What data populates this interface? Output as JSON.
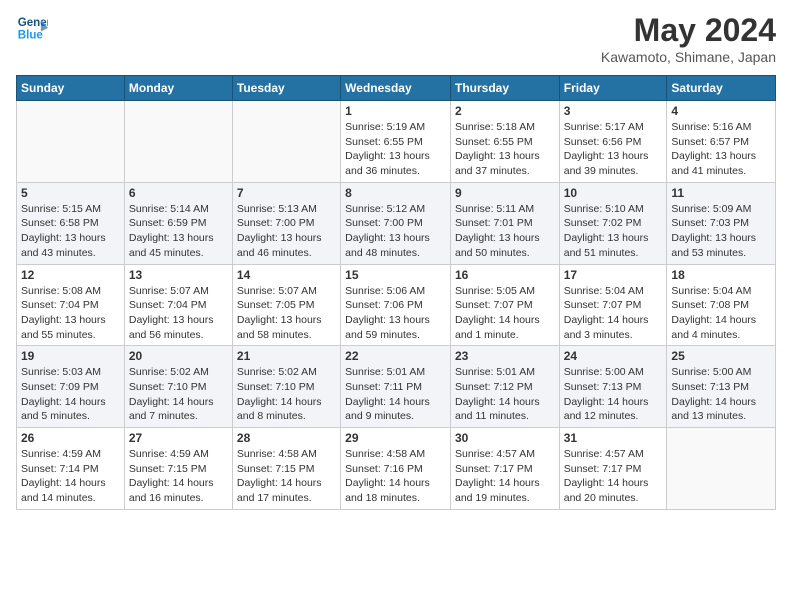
{
  "header": {
    "logo_line1": "General",
    "logo_line2": "Blue",
    "month_year": "May 2024",
    "location": "Kawamoto, Shimane, Japan"
  },
  "weekdays": [
    "Sunday",
    "Monday",
    "Tuesday",
    "Wednesday",
    "Thursday",
    "Friday",
    "Saturday"
  ],
  "weeks": [
    [
      {
        "day": "",
        "info": ""
      },
      {
        "day": "",
        "info": ""
      },
      {
        "day": "",
        "info": ""
      },
      {
        "day": "1",
        "info": "Sunrise: 5:19 AM\nSunset: 6:55 PM\nDaylight: 13 hours\nand 36 minutes."
      },
      {
        "day": "2",
        "info": "Sunrise: 5:18 AM\nSunset: 6:55 PM\nDaylight: 13 hours\nand 37 minutes."
      },
      {
        "day": "3",
        "info": "Sunrise: 5:17 AM\nSunset: 6:56 PM\nDaylight: 13 hours\nand 39 minutes."
      },
      {
        "day": "4",
        "info": "Sunrise: 5:16 AM\nSunset: 6:57 PM\nDaylight: 13 hours\nand 41 minutes."
      }
    ],
    [
      {
        "day": "5",
        "info": "Sunrise: 5:15 AM\nSunset: 6:58 PM\nDaylight: 13 hours\nand 43 minutes."
      },
      {
        "day": "6",
        "info": "Sunrise: 5:14 AM\nSunset: 6:59 PM\nDaylight: 13 hours\nand 45 minutes."
      },
      {
        "day": "7",
        "info": "Sunrise: 5:13 AM\nSunset: 7:00 PM\nDaylight: 13 hours\nand 46 minutes."
      },
      {
        "day": "8",
        "info": "Sunrise: 5:12 AM\nSunset: 7:00 PM\nDaylight: 13 hours\nand 48 minutes."
      },
      {
        "day": "9",
        "info": "Sunrise: 5:11 AM\nSunset: 7:01 PM\nDaylight: 13 hours\nand 50 minutes."
      },
      {
        "day": "10",
        "info": "Sunrise: 5:10 AM\nSunset: 7:02 PM\nDaylight: 13 hours\nand 51 minutes."
      },
      {
        "day": "11",
        "info": "Sunrise: 5:09 AM\nSunset: 7:03 PM\nDaylight: 13 hours\nand 53 minutes."
      }
    ],
    [
      {
        "day": "12",
        "info": "Sunrise: 5:08 AM\nSunset: 7:04 PM\nDaylight: 13 hours\nand 55 minutes."
      },
      {
        "day": "13",
        "info": "Sunrise: 5:07 AM\nSunset: 7:04 PM\nDaylight: 13 hours\nand 56 minutes."
      },
      {
        "day": "14",
        "info": "Sunrise: 5:07 AM\nSunset: 7:05 PM\nDaylight: 13 hours\nand 58 minutes."
      },
      {
        "day": "15",
        "info": "Sunrise: 5:06 AM\nSunset: 7:06 PM\nDaylight: 13 hours\nand 59 minutes."
      },
      {
        "day": "16",
        "info": "Sunrise: 5:05 AM\nSunset: 7:07 PM\nDaylight: 14 hours\nand 1 minute."
      },
      {
        "day": "17",
        "info": "Sunrise: 5:04 AM\nSunset: 7:07 PM\nDaylight: 14 hours\nand 3 minutes."
      },
      {
        "day": "18",
        "info": "Sunrise: 5:04 AM\nSunset: 7:08 PM\nDaylight: 14 hours\nand 4 minutes."
      }
    ],
    [
      {
        "day": "19",
        "info": "Sunrise: 5:03 AM\nSunset: 7:09 PM\nDaylight: 14 hours\nand 5 minutes."
      },
      {
        "day": "20",
        "info": "Sunrise: 5:02 AM\nSunset: 7:10 PM\nDaylight: 14 hours\nand 7 minutes."
      },
      {
        "day": "21",
        "info": "Sunrise: 5:02 AM\nSunset: 7:10 PM\nDaylight: 14 hours\nand 8 minutes."
      },
      {
        "day": "22",
        "info": "Sunrise: 5:01 AM\nSunset: 7:11 PM\nDaylight: 14 hours\nand 9 minutes."
      },
      {
        "day": "23",
        "info": "Sunrise: 5:01 AM\nSunset: 7:12 PM\nDaylight: 14 hours\nand 11 minutes."
      },
      {
        "day": "24",
        "info": "Sunrise: 5:00 AM\nSunset: 7:13 PM\nDaylight: 14 hours\nand 12 minutes."
      },
      {
        "day": "25",
        "info": "Sunrise: 5:00 AM\nSunset: 7:13 PM\nDaylight: 14 hours\nand 13 minutes."
      }
    ],
    [
      {
        "day": "26",
        "info": "Sunrise: 4:59 AM\nSunset: 7:14 PM\nDaylight: 14 hours\nand 14 minutes."
      },
      {
        "day": "27",
        "info": "Sunrise: 4:59 AM\nSunset: 7:15 PM\nDaylight: 14 hours\nand 16 minutes."
      },
      {
        "day": "28",
        "info": "Sunrise: 4:58 AM\nSunset: 7:15 PM\nDaylight: 14 hours\nand 17 minutes."
      },
      {
        "day": "29",
        "info": "Sunrise: 4:58 AM\nSunset: 7:16 PM\nDaylight: 14 hours\nand 18 minutes."
      },
      {
        "day": "30",
        "info": "Sunrise: 4:57 AM\nSunset: 7:17 PM\nDaylight: 14 hours\nand 19 minutes."
      },
      {
        "day": "31",
        "info": "Sunrise: 4:57 AM\nSunset: 7:17 PM\nDaylight: 14 hours\nand 20 minutes."
      },
      {
        "day": "",
        "info": ""
      }
    ]
  ]
}
